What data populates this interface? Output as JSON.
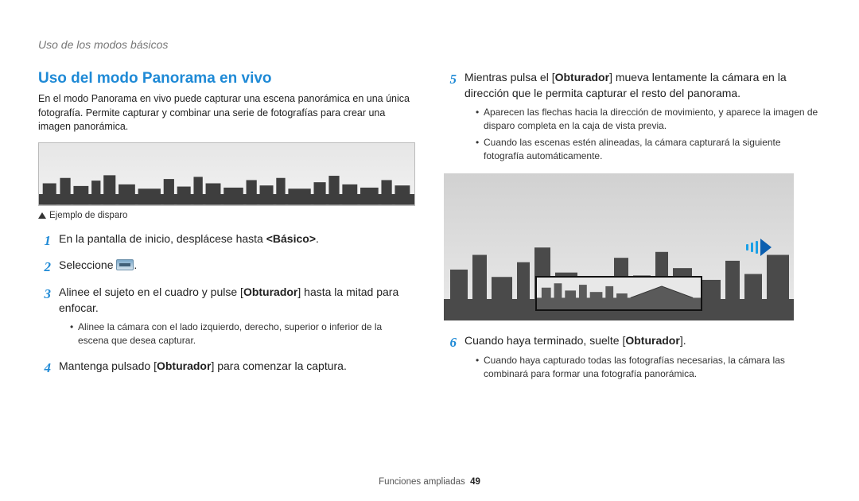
{
  "running_head": "Uso de los modos básicos",
  "section_title": "Uso del modo Panorama en vivo",
  "intro": "En el modo Panorama en vivo puede capturar una escena panorámica en una única fotografía. Permite capturar y combinar una serie de fotografías para crear una imagen panorámica.",
  "example_caption": "Ejemplo de disparo",
  "steps_left": {
    "s1_pre": "En la pantalla de inicio, desplácese hasta ",
    "s1_bold": "<Básico>",
    "s1_post": ".",
    "s2_pre": "Seleccione ",
    "s2_post": ".",
    "s3_pre": "Alinee el sujeto en el cuadro y pulse [",
    "s3_bold": "Obturador",
    "s3_post": "] hasta la mitad para enfocar.",
    "s3_sub1": "Alinee la cámara con el lado izquierdo, derecho, superior o inferior de la escena que desea capturar.",
    "s4_pre": "Mantenga pulsado [",
    "s4_bold": "Obturador",
    "s4_post": "] para comenzar la captura."
  },
  "steps_right": {
    "s5_pre": "Mientras pulsa el [",
    "s5_bold": "Obturador",
    "s5_post": "] mueva lentamente la cámara en la dirección que le permita capturar el resto del panorama.",
    "s5_sub1": "Aparecen las flechas hacia la dirección de movimiento, y aparece la imagen de disparo completa en la caja de vista previa.",
    "s5_sub2": "Cuando las escenas estén alineadas, la cámara capturará la siguiente fotografía automáticamente.",
    "s6_pre": "Cuando haya terminado, suelte [",
    "s6_bold": "Obturador",
    "s6_post": "].",
    "s6_sub1": "Cuando haya capturado todas las fotografías necesarias, la cámara las combinará para formar una fotografía panorámica."
  },
  "nums": {
    "n1": "1",
    "n2": "2",
    "n3": "3",
    "n4": "4",
    "n5": "5",
    "n6": "6"
  },
  "footer_label": "Funciones ampliadas",
  "footer_page": "49"
}
